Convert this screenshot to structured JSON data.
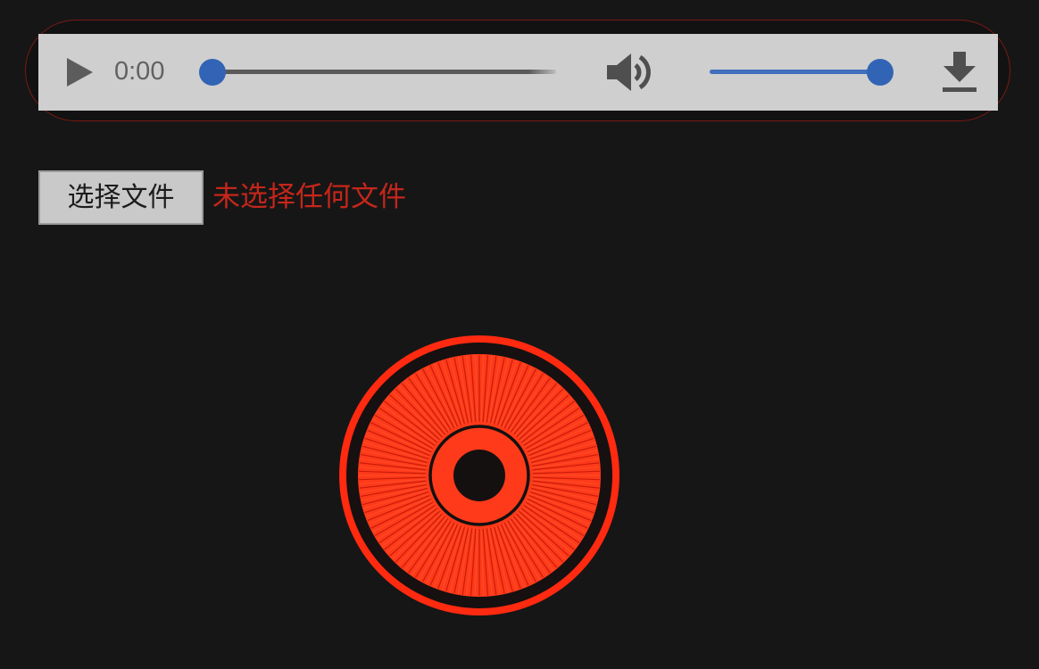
{
  "player": {
    "time": "0:00",
    "progress": 0,
    "volume": 1.0,
    "icons": {
      "play": "play-icon",
      "volume": "speaker-icon",
      "download": "download-icon"
    },
    "colors": {
      "bar": "#cfcfcf",
      "accent": "#3264b5"
    }
  },
  "file_input": {
    "button_label": "选择文件",
    "status_text": "未选择任何文件",
    "status_color": "#c5261b"
  },
  "visualizer": {
    "color": "#ff2a10"
  }
}
